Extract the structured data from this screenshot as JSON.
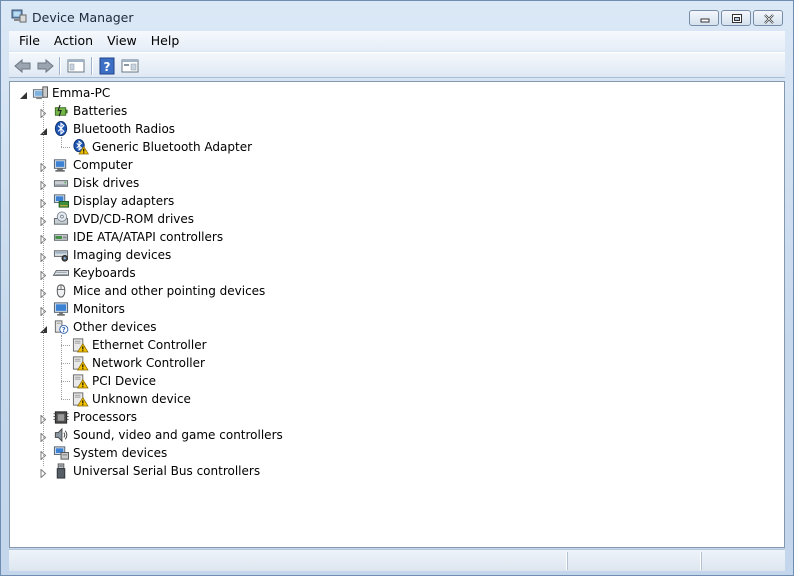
{
  "window": {
    "title": "Device Manager"
  },
  "menu": {
    "items": [
      "File",
      "Action",
      "View",
      "Help"
    ]
  },
  "toolbar": {
    "buttons": [
      "back-arrow-icon",
      "forward-arrow-icon",
      "show-hide-console-tree-icon",
      "help-icon",
      "properties-icon"
    ]
  },
  "tree": {
    "root": "Emma-PC",
    "categories": [
      {
        "label": "Batteries",
        "icon": "battery-icon",
        "expanded": false
      },
      {
        "label": "Bluetooth Radios",
        "icon": "bluetooth-icon",
        "expanded": true,
        "children": [
          {
            "label": "Generic Bluetooth Adapter",
            "icon": "bluetooth-warning-icon"
          }
        ]
      },
      {
        "label": "Computer",
        "icon": "computer-icon",
        "expanded": false
      },
      {
        "label": "Disk drives",
        "icon": "disk-drive-icon",
        "expanded": false
      },
      {
        "label": "Display adapters",
        "icon": "display-adapter-icon",
        "expanded": false
      },
      {
        "label": "DVD/CD-ROM drives",
        "icon": "dvd-drive-icon",
        "expanded": false
      },
      {
        "label": "IDE ATA/ATAPI controllers",
        "icon": "ide-controller-icon",
        "expanded": false
      },
      {
        "label": "Imaging devices",
        "icon": "imaging-device-icon",
        "expanded": false
      },
      {
        "label": "Keyboards",
        "icon": "keyboard-icon",
        "expanded": false
      },
      {
        "label": "Mice and other pointing devices",
        "icon": "mouse-icon",
        "expanded": false
      },
      {
        "label": "Monitors",
        "icon": "monitor-icon",
        "expanded": false
      },
      {
        "label": "Other devices",
        "icon": "unknown-device-icon",
        "expanded": true,
        "children": [
          {
            "label": "Ethernet Controller",
            "icon": "device-warning-icon"
          },
          {
            "label": "Network Controller",
            "icon": "device-warning-icon"
          },
          {
            "label": "PCI Device",
            "icon": "device-warning-icon"
          },
          {
            "label": "Unknown device",
            "icon": "device-warning-icon"
          }
        ]
      },
      {
        "label": "Processors",
        "icon": "processor-icon",
        "expanded": false
      },
      {
        "label": "Sound, video and game controllers",
        "icon": "speaker-icon",
        "expanded": false
      },
      {
        "label": "System devices",
        "icon": "system-device-icon",
        "expanded": false
      },
      {
        "label": "Universal Serial Bus controllers",
        "icon": "usb-icon",
        "expanded": false
      }
    ]
  },
  "colors": {
    "frame": "#c6d8ec",
    "warning": "#f2c200"
  }
}
